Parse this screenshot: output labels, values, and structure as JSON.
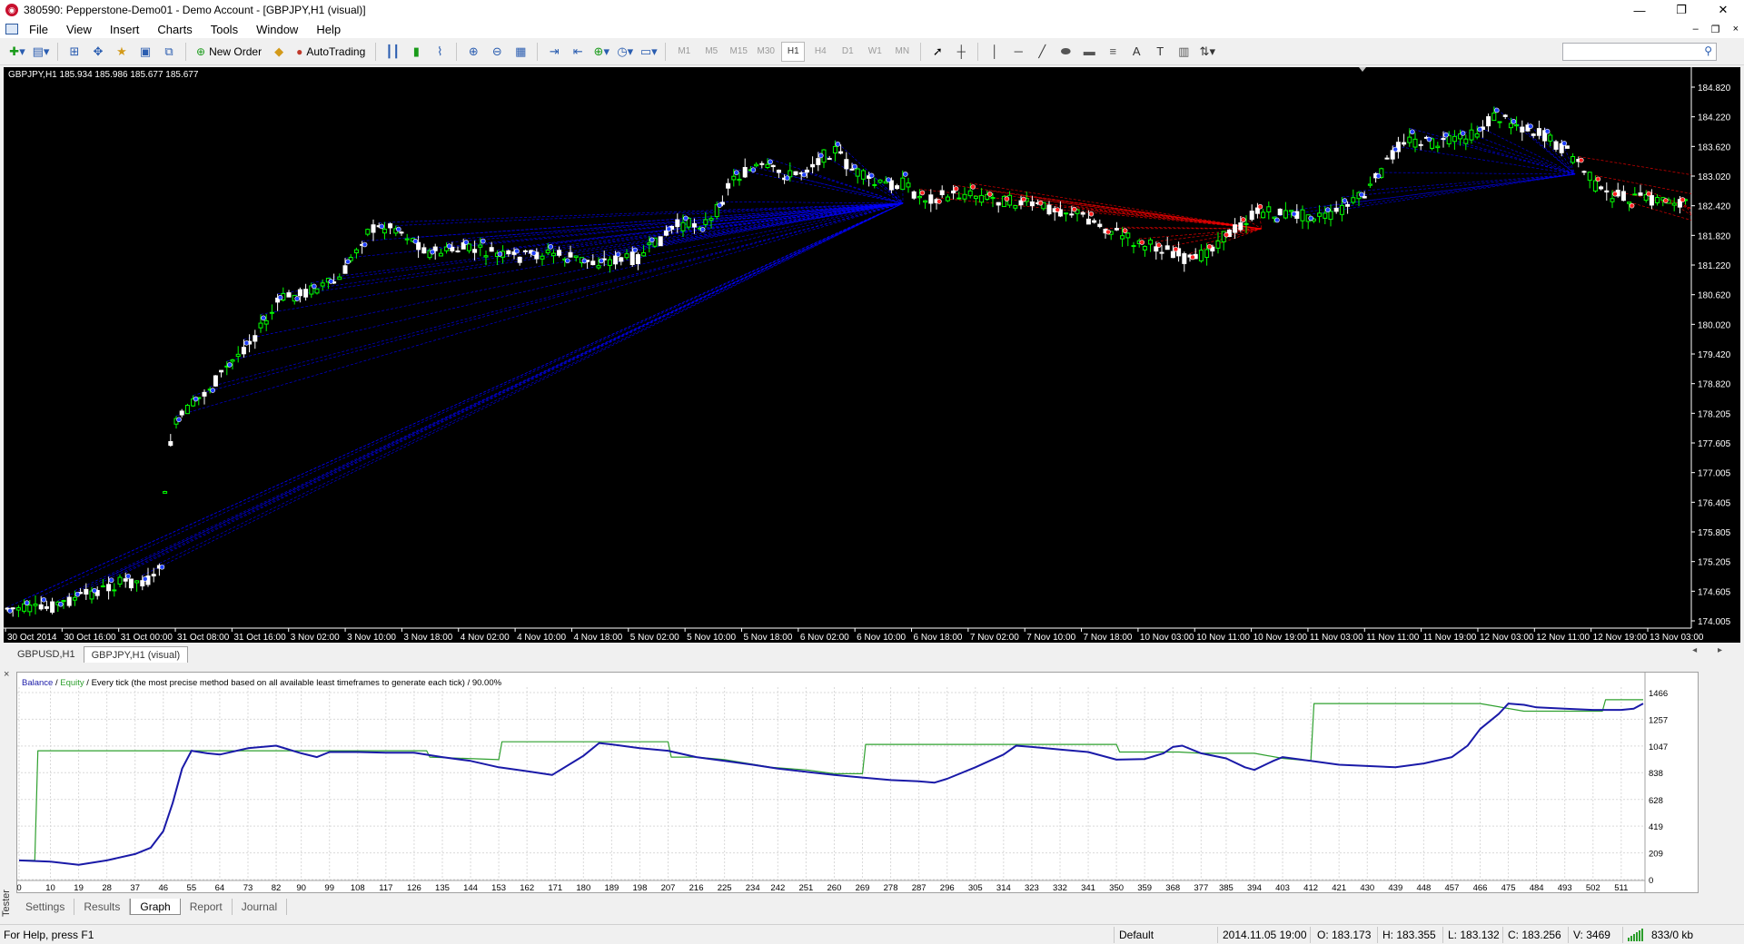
{
  "window": {
    "title": "380590: Pepperstone-Demo01 - Demo Account - [GBPJPY,H1 (visual)]",
    "buttons": [
      "—",
      "❐",
      "✕"
    ],
    "mdi_buttons": [
      "–",
      "❐",
      "×"
    ]
  },
  "menu": [
    "File",
    "View",
    "Insert",
    "Charts",
    "Tools",
    "Window",
    "Help"
  ],
  "toolbar": {
    "new_order": "New Order",
    "autotrading": "AutoTrading",
    "timeframes": [
      "M1",
      "M5",
      "M15",
      "M30",
      "H1",
      "H4",
      "D1",
      "W1",
      "MN"
    ],
    "active_timeframe": "H1",
    "text_tool": "A",
    "label_tool": "T"
  },
  "chart": {
    "info": "GBPJPY,H1  185.934 185.986 185.677 185.677",
    "price_labels": [
      "184.820",
      "184.220",
      "183.620",
      "183.020",
      "182.420",
      "181.820",
      "181.220",
      "180.620",
      "180.020",
      "179.420",
      "178.820",
      "178.205",
      "177.605",
      "177.005",
      "176.405",
      "175.805",
      "175.205",
      "174.605",
      "174.005"
    ],
    "time_labels": [
      "30 Oct 2014",
      "30 Oct 16:00",
      "31 Oct 00:00",
      "31 Oct 08:00",
      "31 Oct 16:00",
      "3 Nov 02:00",
      "3 Nov 10:00",
      "3 Nov 18:00",
      "4 Nov 02:00",
      "4 Nov 10:00",
      "4 Nov 18:00",
      "5 Nov 02:00",
      "5 Nov 10:00",
      "5 Nov 18:00",
      "6 Nov 02:00",
      "6 Nov 10:00",
      "6 Nov 18:00",
      "7 Nov 02:00",
      "7 Nov 10:00",
      "7 Nov 18:00",
      "10 Nov 03:00",
      "10 Nov 11:00",
      "10 Nov 19:00",
      "11 Nov 03:00",
      "11 Nov 11:00",
      "11 Nov 19:00",
      "12 Nov 03:00",
      "12 Nov 11:00",
      "12 Nov 19:00",
      "13 Nov 03:00"
    ],
    "bull_color": "#00ff00",
    "bear_color": "#ffffff",
    "buy_line_color": "#0000ff",
    "sell_line_color": "#ff0000"
  },
  "chart_tabs": [
    "GBPUSD,H1",
    "GBPJPY,H1 (visual)"
  ],
  "active_chart_tab": "GBPJPY,H1 (visual)",
  "chart_tab_arrows": "◂ ▸",
  "tester": {
    "label": "Tester",
    "close": "×",
    "legend_balance": "Balance",
    "legend_sep": " / ",
    "legend_equity": "Equity",
    "legend_rest": " / Every tick (the most precise method based on all available least timeframes to generate each tick) / 90.00%",
    "tabs": [
      "Settings",
      "Results",
      "Graph",
      "Report",
      "Journal"
    ],
    "active_tab": "Graph"
  },
  "status": {
    "help": "For Help, press F1",
    "profile": "Default",
    "datetime": "2014.11.05 19:00",
    "open": "O: 183.173",
    "high": "H: 183.355",
    "low": "L: 183.132",
    "close": "C: 183.256",
    "volume": "V: 3469",
    "traffic": "833/0 kb"
  },
  "chart_data": {
    "type": "line",
    "x_tick_labels": [
      "0",
      "10",
      "19",
      "28",
      "37",
      "46",
      "55",
      "64",
      "73",
      "82",
      "90",
      "99",
      "108",
      "117",
      "126",
      "135",
      "144",
      "153",
      "162",
      "171",
      "180",
      "189",
      "198",
      "207",
      "216",
      "225",
      "234",
      "242",
      "251",
      "260",
      "269",
      "278",
      "287",
      "296",
      "305",
      "314",
      "323",
      "332",
      "341",
      "350",
      "359",
      "368",
      "377",
      "385",
      "394",
      "403",
      "412",
      "421",
      "430",
      "439",
      "448",
      "457",
      "466",
      "475",
      "484",
      "493",
      "502",
      "511"
    ],
    "y_tick_labels": [
      "1466",
      "1257",
      "1047",
      "838",
      "628",
      "419",
      "209",
      "0"
    ],
    "ylim": [
      0,
      1466
    ],
    "xlim": [
      0,
      518
    ],
    "series": [
      {
        "name": "Balance",
        "color": "#1a1aa8",
        "points": [
          [
            0,
            150
          ],
          [
            10,
            140
          ],
          [
            19,
            115
          ],
          [
            28,
            150
          ],
          [
            37,
            200
          ],
          [
            42,
            250
          ],
          [
            46,
            380
          ],
          [
            49,
            600
          ],
          [
            52,
            870
          ],
          [
            55,
            1010
          ],
          [
            60,
            990
          ],
          [
            64,
            980
          ],
          [
            73,
            1030
          ],
          [
            82,
            1050
          ],
          [
            90,
            990
          ],
          [
            95,
            960
          ],
          [
            99,
            1000
          ],
          [
            108,
            1000
          ],
          [
            117,
            995
          ],
          [
            126,
            995
          ],
          [
            135,
            960
          ],
          [
            144,
            930
          ],
          [
            153,
            880
          ],
          [
            162,
            850
          ],
          [
            170,
            820
          ],
          [
            180,
            970
          ],
          [
            185,
            1070
          ],
          [
            189,
            1060
          ],
          [
            198,
            1030
          ],
          [
            207,
            1010
          ],
          [
            216,
            960
          ],
          [
            225,
            930
          ],
          [
            234,
            900
          ],
          [
            242,
            870
          ],
          [
            251,
            845
          ],
          [
            260,
            820
          ],
          [
            269,
            800
          ],
          [
            278,
            780
          ],
          [
            287,
            770
          ],
          [
            292,
            760
          ],
          [
            296,
            790
          ],
          [
            305,
            880
          ],
          [
            314,
            980
          ],
          [
            318,
            1050
          ],
          [
            323,
            1040
          ],
          [
            332,
            1020
          ],
          [
            341,
            1000
          ],
          [
            350,
            940
          ],
          [
            359,
            945
          ],
          [
            365,
            990
          ],
          [
            368,
            1040
          ],
          [
            371,
            1050
          ],
          [
            377,
            990
          ],
          [
            385,
            950
          ],
          [
            391,
            880
          ],
          [
            394,
            860
          ],
          [
            400,
            930
          ],
          [
            403,
            960
          ],
          [
            412,
            930
          ],
          [
            421,
            900
          ],
          [
            430,
            890
          ],
          [
            439,
            880
          ],
          [
            448,
            910
          ],
          [
            457,
            960
          ],
          [
            462,
            1050
          ],
          [
            466,
            1180
          ],
          [
            472,
            1300
          ],
          [
            475,
            1380
          ],
          [
            480,
            1370
          ],
          [
            484,
            1350
          ],
          [
            493,
            1340
          ],
          [
            502,
            1330
          ],
          [
            511,
            1330
          ],
          [
            515,
            1340
          ],
          [
            518,
            1380
          ]
        ]
      },
      {
        "name": "Equity",
        "color": "#2fa02f",
        "points": [
          [
            0,
            150
          ],
          [
            5,
            150
          ],
          [
            6,
            1010
          ],
          [
            55,
            1010
          ],
          [
            130,
            1010
          ],
          [
            131,
            960
          ],
          [
            153,
            940
          ],
          [
            154,
            1080
          ],
          [
            207,
            1080
          ],
          [
            208,
            960
          ],
          [
            216,
            960
          ],
          [
            225,
            940
          ],
          [
            240,
            880
          ],
          [
            251,
            860
          ],
          [
            260,
            830
          ],
          [
            269,
            830
          ],
          [
            270,
            1060
          ],
          [
            296,
            1060
          ],
          [
            314,
            1060
          ],
          [
            350,
            1060
          ],
          [
            351,
            1000
          ],
          [
            370,
            1000
          ],
          [
            377,
            990
          ],
          [
            394,
            990
          ],
          [
            403,
            950
          ],
          [
            412,
            930
          ],
          [
            413,
            1380
          ],
          [
            466,
            1380
          ],
          [
            480,
            1320
          ],
          [
            505,
            1320
          ],
          [
            506,
            1410
          ],
          [
            518,
            1410
          ]
        ]
      }
    ]
  }
}
